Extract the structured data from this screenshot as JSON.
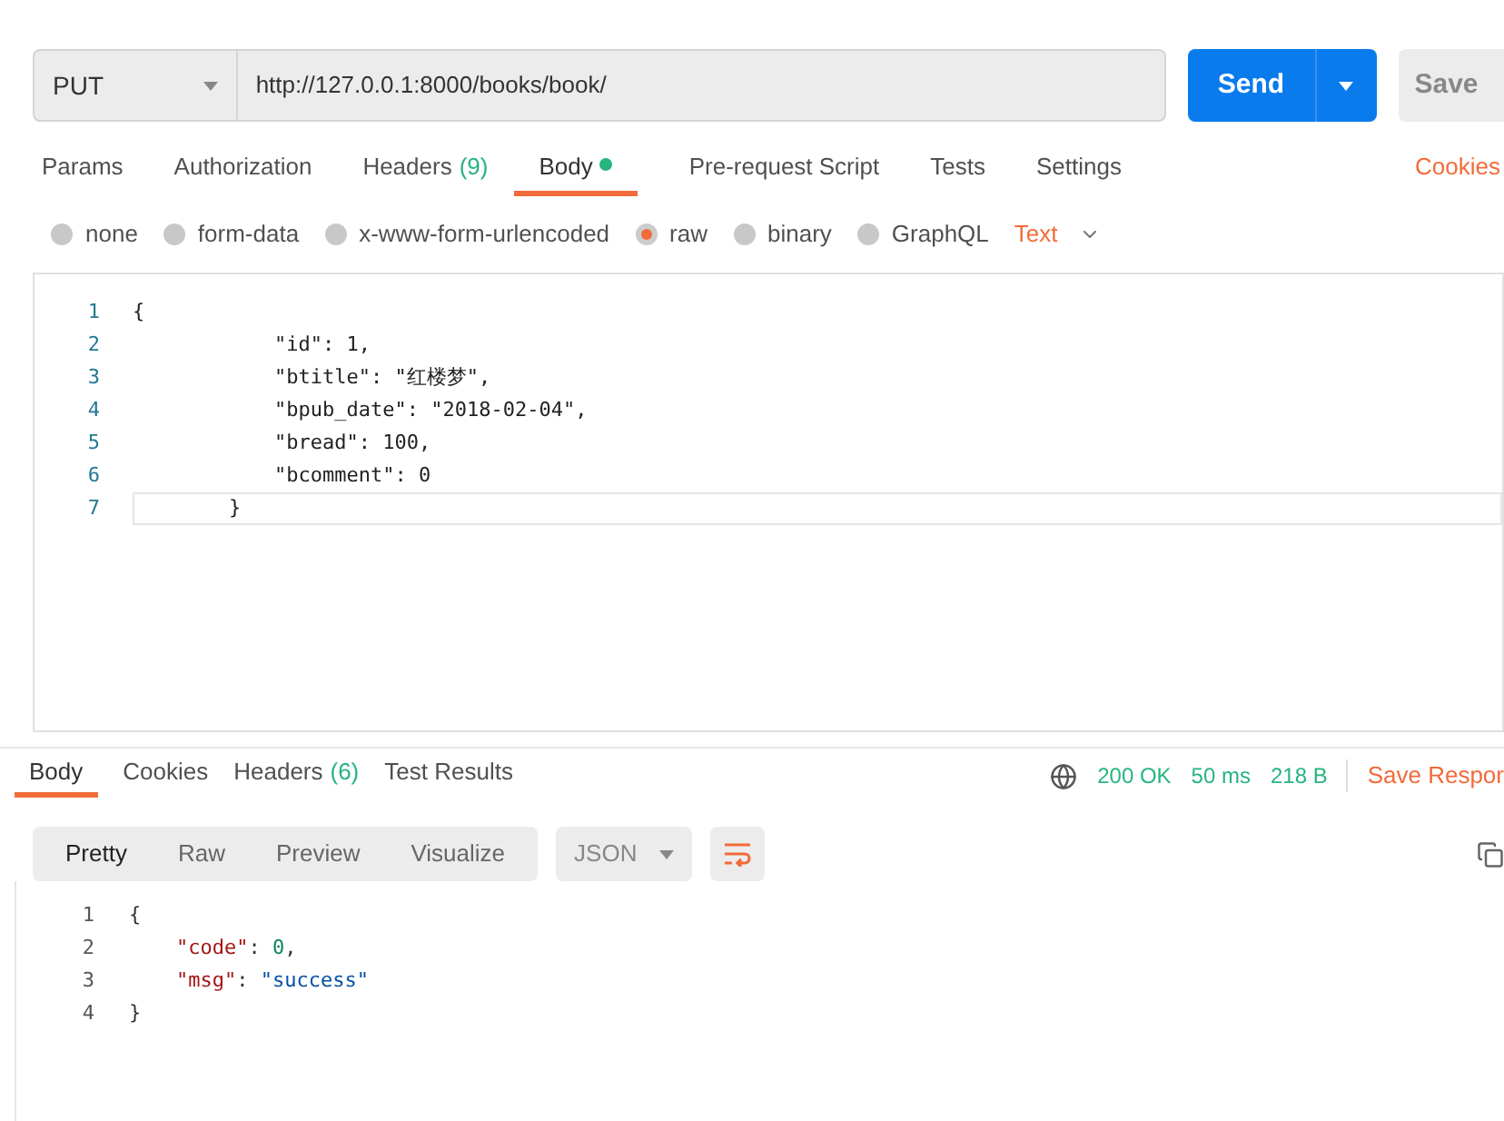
{
  "request": {
    "method": "PUT",
    "url": "http://127.0.0.1:8000/books/book/",
    "send": "Send",
    "save": "Save"
  },
  "tabs": [
    {
      "label": "Params",
      "selected": false
    },
    {
      "label": "Authorization",
      "selected": false
    },
    {
      "label": "Headers",
      "count": "(9)",
      "selected": false
    },
    {
      "label": "Body",
      "dot": true,
      "selected": true
    },
    {
      "label": "Pre-request Script",
      "selected": false
    },
    {
      "label": "Tests",
      "selected": false
    },
    {
      "label": "Settings",
      "selected": false
    }
  ],
  "cookies_link": "Cookies",
  "body_types": [
    {
      "label": "none",
      "selected": false
    },
    {
      "label": "form-data",
      "selected": false
    },
    {
      "label": "x-www-form-urlencoded",
      "selected": false
    },
    {
      "label": "raw",
      "selected": true
    },
    {
      "label": "binary",
      "selected": false
    },
    {
      "label": "GraphQL",
      "selected": false
    }
  ],
  "raw_format": "Text",
  "editor_lines": [
    {
      "number": "1",
      "text": "{",
      "kind": "open"
    },
    {
      "number": "2",
      "text": "\"id\": 1,",
      "kind": "member"
    },
    {
      "number": "3",
      "text": "\"btitle\": \"红楼梦\",",
      "kind": "member"
    },
    {
      "number": "4",
      "text": "\"bpub_date\": \"2018-02-04\",",
      "kind": "member"
    },
    {
      "number": "5",
      "text": "\"bread\": 100,",
      "kind": "member"
    },
    {
      "number": "6",
      "text": "\"bcomment\": 0",
      "kind": "member"
    },
    {
      "number": "7",
      "text": "}",
      "kind": "close"
    }
  ],
  "response_tabs": [
    {
      "label": "Body",
      "selected": true
    },
    {
      "label": "Cookies",
      "selected": false
    },
    {
      "label": "Headers",
      "count": "(6)",
      "selected": false
    },
    {
      "label": "Test Results",
      "selected": false
    }
  ],
  "status": {
    "code": "200 OK",
    "time": "50 ms",
    "size": "218 B",
    "save_response": "Save Respor"
  },
  "view_modes": [
    {
      "label": "Pretty",
      "selected": true
    },
    {
      "label": "Raw",
      "selected": false
    },
    {
      "label": "Preview",
      "selected": false
    },
    {
      "label": "Visualize",
      "selected": false
    }
  ],
  "response_format": "JSON",
  "response_lines": [
    {
      "number": "1",
      "tokens": [
        {
          "text": "{",
          "kind": "brace"
        }
      ]
    },
    {
      "number": "2",
      "tokens": [
        {
          "text": "\"code\"",
          "kind": "key"
        },
        {
          "text": ": ",
          "kind": "punct"
        },
        {
          "text": "0",
          "kind": "number"
        },
        {
          "text": ",",
          "kind": "punct"
        }
      ]
    },
    {
      "number": "3",
      "tokens": [
        {
          "text": "\"msg\"",
          "kind": "key"
        },
        {
          "text": ": ",
          "kind": "punct"
        },
        {
          "text": "\"success\"",
          "kind": "string"
        }
      ]
    },
    {
      "number": "4",
      "tokens": [
        {
          "text": "}",
          "kind": "brace"
        }
      ]
    }
  ]
}
